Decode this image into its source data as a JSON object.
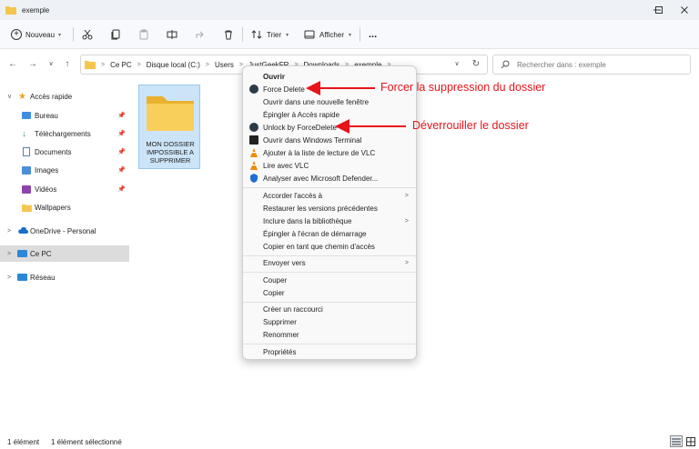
{
  "window": {
    "title": "exemple",
    "folder_color": "#f5c64e"
  },
  "toolbar": {
    "new_label": "Nouveau",
    "sort_label": "Trier",
    "view_label": "Afficher",
    "more_label": "..."
  },
  "address": {
    "crumbs": [
      "Ce PC",
      "Disque local (C:)",
      "Users",
      "JustGeekFR",
      "Downloads",
      "exemple"
    ],
    "search_placeholder": "Rechercher dans : exemple"
  },
  "sidebar": {
    "quick_access": "Accès rapide",
    "items": [
      {
        "label": "Bureau",
        "icon": "desktop-icon",
        "pinned": true
      },
      {
        "label": "Téléchargements",
        "icon": "download-icon",
        "pinned": true
      },
      {
        "label": "Documents",
        "icon": "document-icon",
        "pinned": true
      },
      {
        "label": "Images",
        "icon": "image-icon",
        "pinned": true
      },
      {
        "label": "Vidéos",
        "icon": "video-icon",
        "pinned": true
      },
      {
        "label": "Wallpapers",
        "icon": "folder-icon",
        "pinned": false
      }
    ],
    "onedrive": "OneDrive - Personal",
    "this_pc": "Ce PC",
    "network": "Réseau"
  },
  "content": {
    "folder_name": "MON DOSSIER IMPOSSIBLE A SUPPRIMER"
  },
  "context_menu": {
    "items": [
      {
        "label": "Ouvrir",
        "bold": true
      },
      {
        "label": "Force Delete",
        "icon": "forcedelete-icon"
      },
      {
        "label": "Ouvrir dans une nouvelle fenêtre"
      },
      {
        "label": "Épingler à Accès rapide"
      },
      {
        "label": "Unlock by ForceDelete",
        "icon": "forcedelete-icon"
      },
      {
        "label": "Ouvrir dans Windows Terminal",
        "icon": "terminal-icon"
      },
      {
        "label": "Ajouter à la liste de lecture de VLC",
        "icon": "vlc-icon"
      },
      {
        "label": "Lire avec VLC",
        "icon": "vlc-icon"
      },
      {
        "label": "Analyser avec Microsoft Defender...",
        "icon": "defender-icon"
      },
      {
        "label": "Accorder l'accès à",
        "submenu": true
      },
      {
        "label": "Restaurer les versions précédentes"
      },
      {
        "label": "Inclure dans la bibliothèque",
        "submenu": true
      },
      {
        "label": "Épingler à l'écran de démarrage"
      },
      {
        "label": "Copier en tant que chemin d'accès"
      },
      {
        "label": "Envoyer vers",
        "submenu": true
      },
      {
        "label": "Couper"
      },
      {
        "label": "Copier"
      },
      {
        "label": "Créer un raccourci"
      },
      {
        "label": "Supprimer"
      },
      {
        "label": "Renommer"
      },
      {
        "label": "Propriétés"
      }
    ]
  },
  "annotations": {
    "force_delete": "Forcer la suppression du dossier",
    "unlock": "Déverrouiller le dossier",
    "color": "#e8131b"
  },
  "status": {
    "count": "1 élément",
    "selected": "1 élément sélectionné"
  }
}
